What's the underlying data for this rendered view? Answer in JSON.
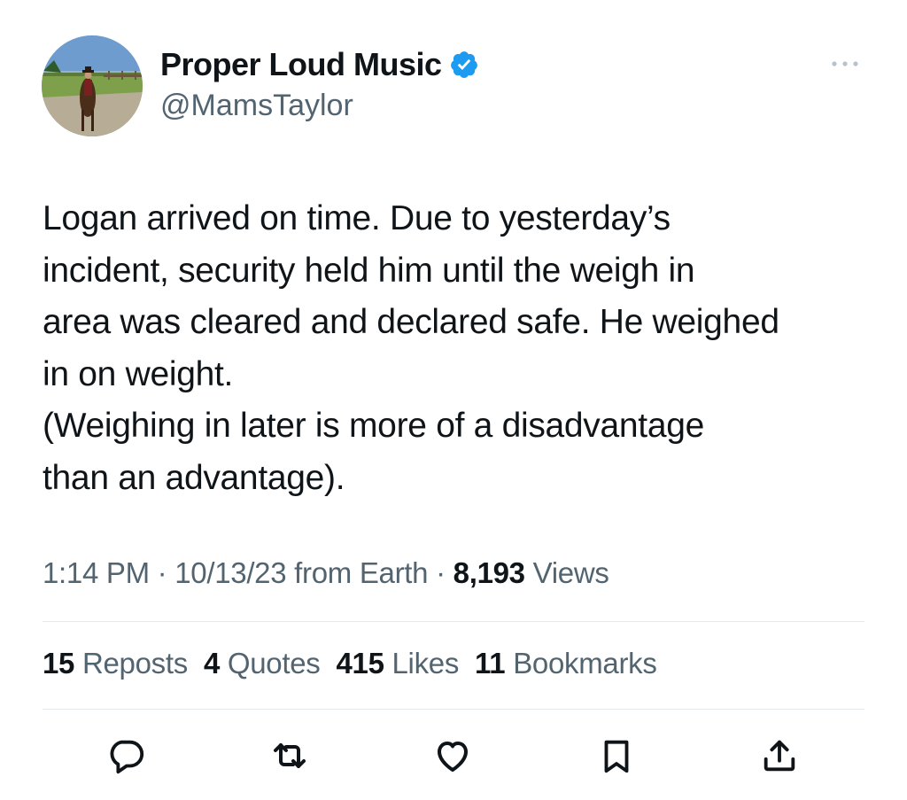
{
  "author": {
    "name": "Proper Loud Music",
    "handle": "@MamsTaylor",
    "verified": true
  },
  "tweet": {
    "text": "Logan arrived on time. Due to yesterday’s\nincident, security held him until the weigh in\narea was cleared and declared safe. He weighed\nin on weight.\n(Weighing in later is more of a disadvantage\nthan an advantage)."
  },
  "meta": {
    "time": "1:14 PM",
    "sep1": " · ",
    "date": "10/13/23",
    "source": " from Earth",
    "sep2": " · ",
    "views_count": "8,193",
    "views_label": " Views"
  },
  "stats": {
    "reposts_count": "15",
    "reposts_label": " Reposts",
    "quotes_count": "4",
    "quotes_label": " Quotes",
    "likes_count": "415",
    "likes_label": " Likes",
    "bookmarks_count": "11",
    "bookmarks_label": " Bookmarks"
  },
  "icons": {
    "verified": "verified-badge-icon",
    "more": "more-options-icon",
    "reply": "reply-icon",
    "repost": "repost-icon",
    "like": "like-icon",
    "bookmark": "bookmark-icon",
    "share": "share-icon"
  },
  "colors": {
    "text": "#0f1419",
    "secondary": "#536471",
    "verified": "#1d9bf0",
    "divider": "#e6e9ec"
  }
}
